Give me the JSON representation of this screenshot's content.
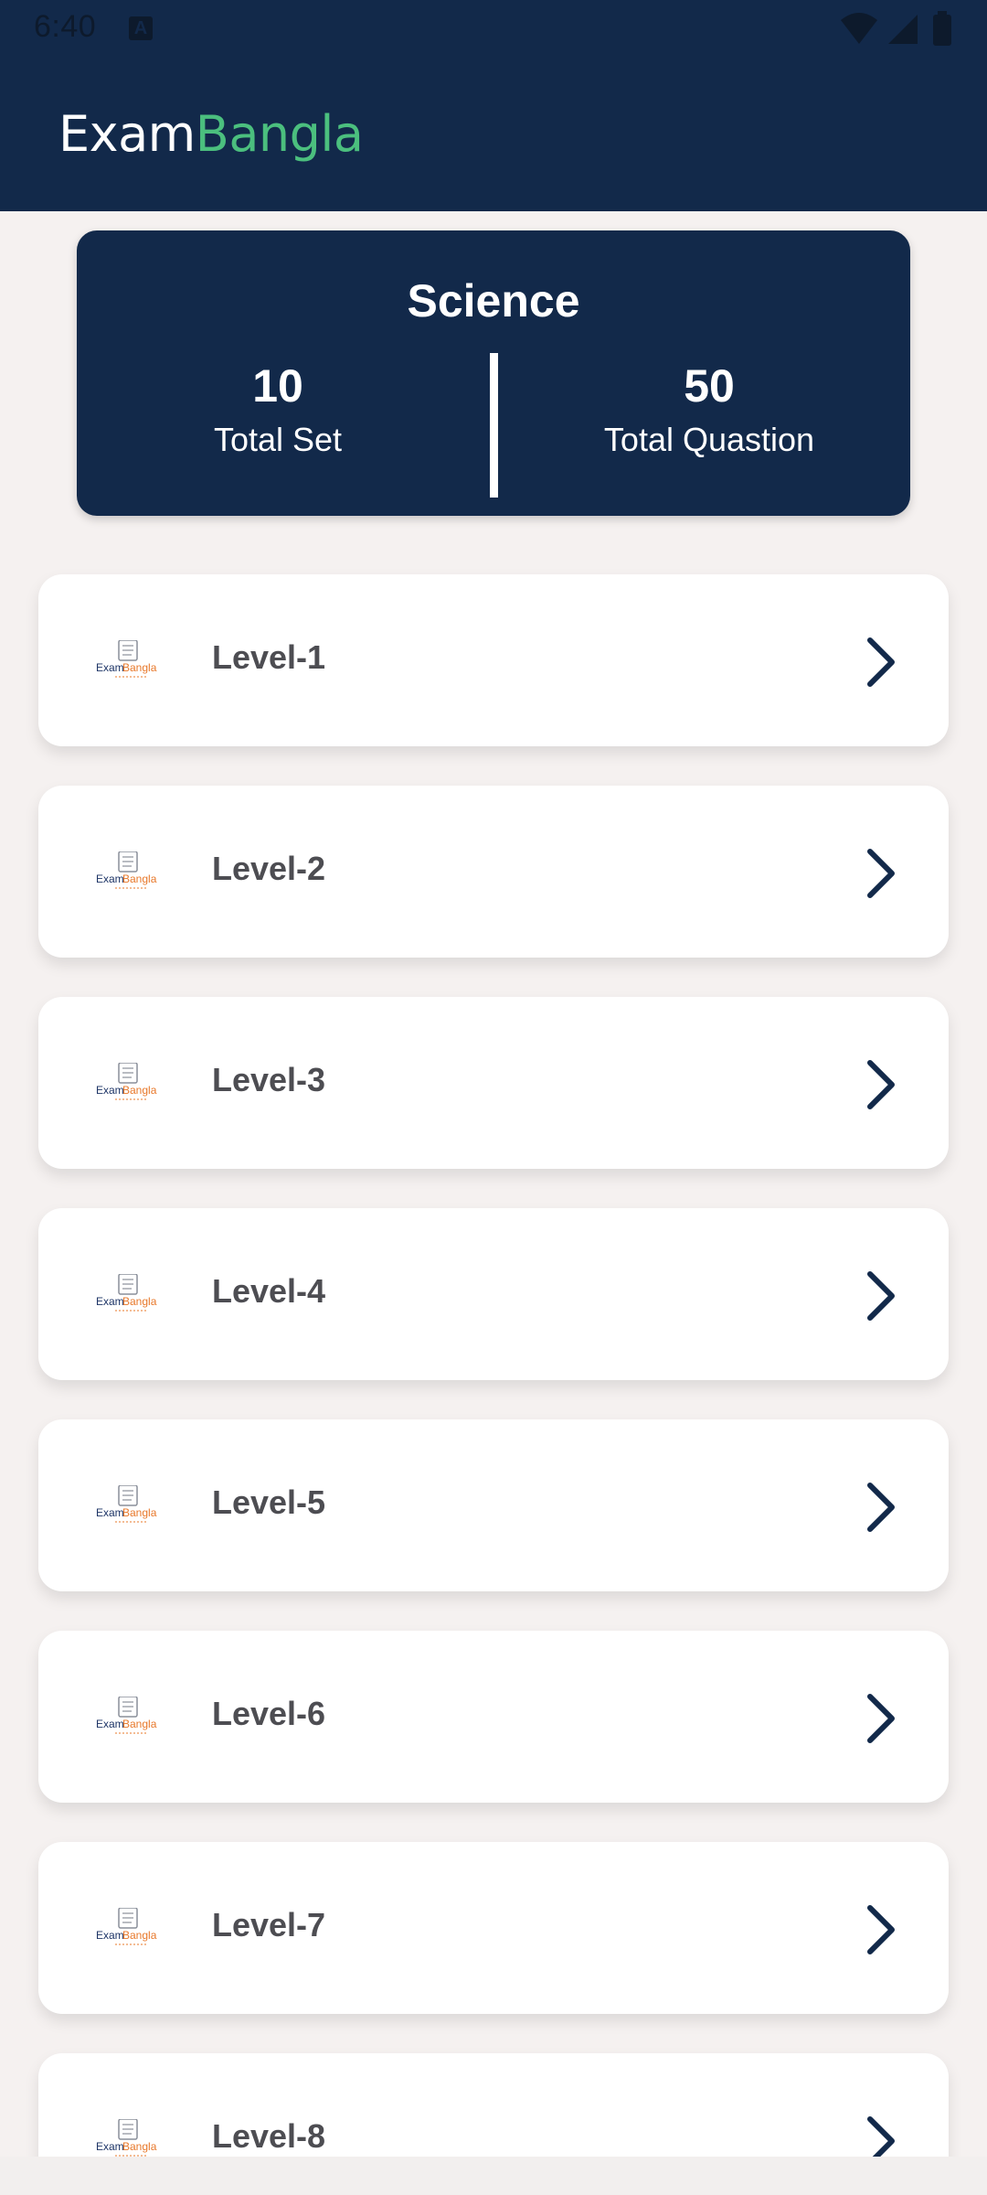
{
  "status_bar": {
    "time": "6:40",
    "icons": [
      "a-icon",
      "wifi-icon",
      "signal-icon",
      "battery-icon"
    ]
  },
  "app": {
    "brand_exam": "Exam",
    "brand_bangla": "Bangla",
    "colors": {
      "header": "#12294a",
      "brand_accent": "#4bbf7e",
      "chevron": "#12294a"
    }
  },
  "summary": {
    "subject": "Science",
    "total_set_value": "10",
    "total_set_label": "Total Set",
    "total_question_value": "50",
    "total_question_label": "Total Quastion"
  },
  "levels": [
    {
      "label": "Level-1"
    },
    {
      "label": "Level-2"
    },
    {
      "label": "Level-3"
    },
    {
      "label": "Level-4"
    },
    {
      "label": "Level-5"
    },
    {
      "label": "Level-6"
    },
    {
      "label": "Level-7"
    },
    {
      "label": "Level-8"
    }
  ]
}
